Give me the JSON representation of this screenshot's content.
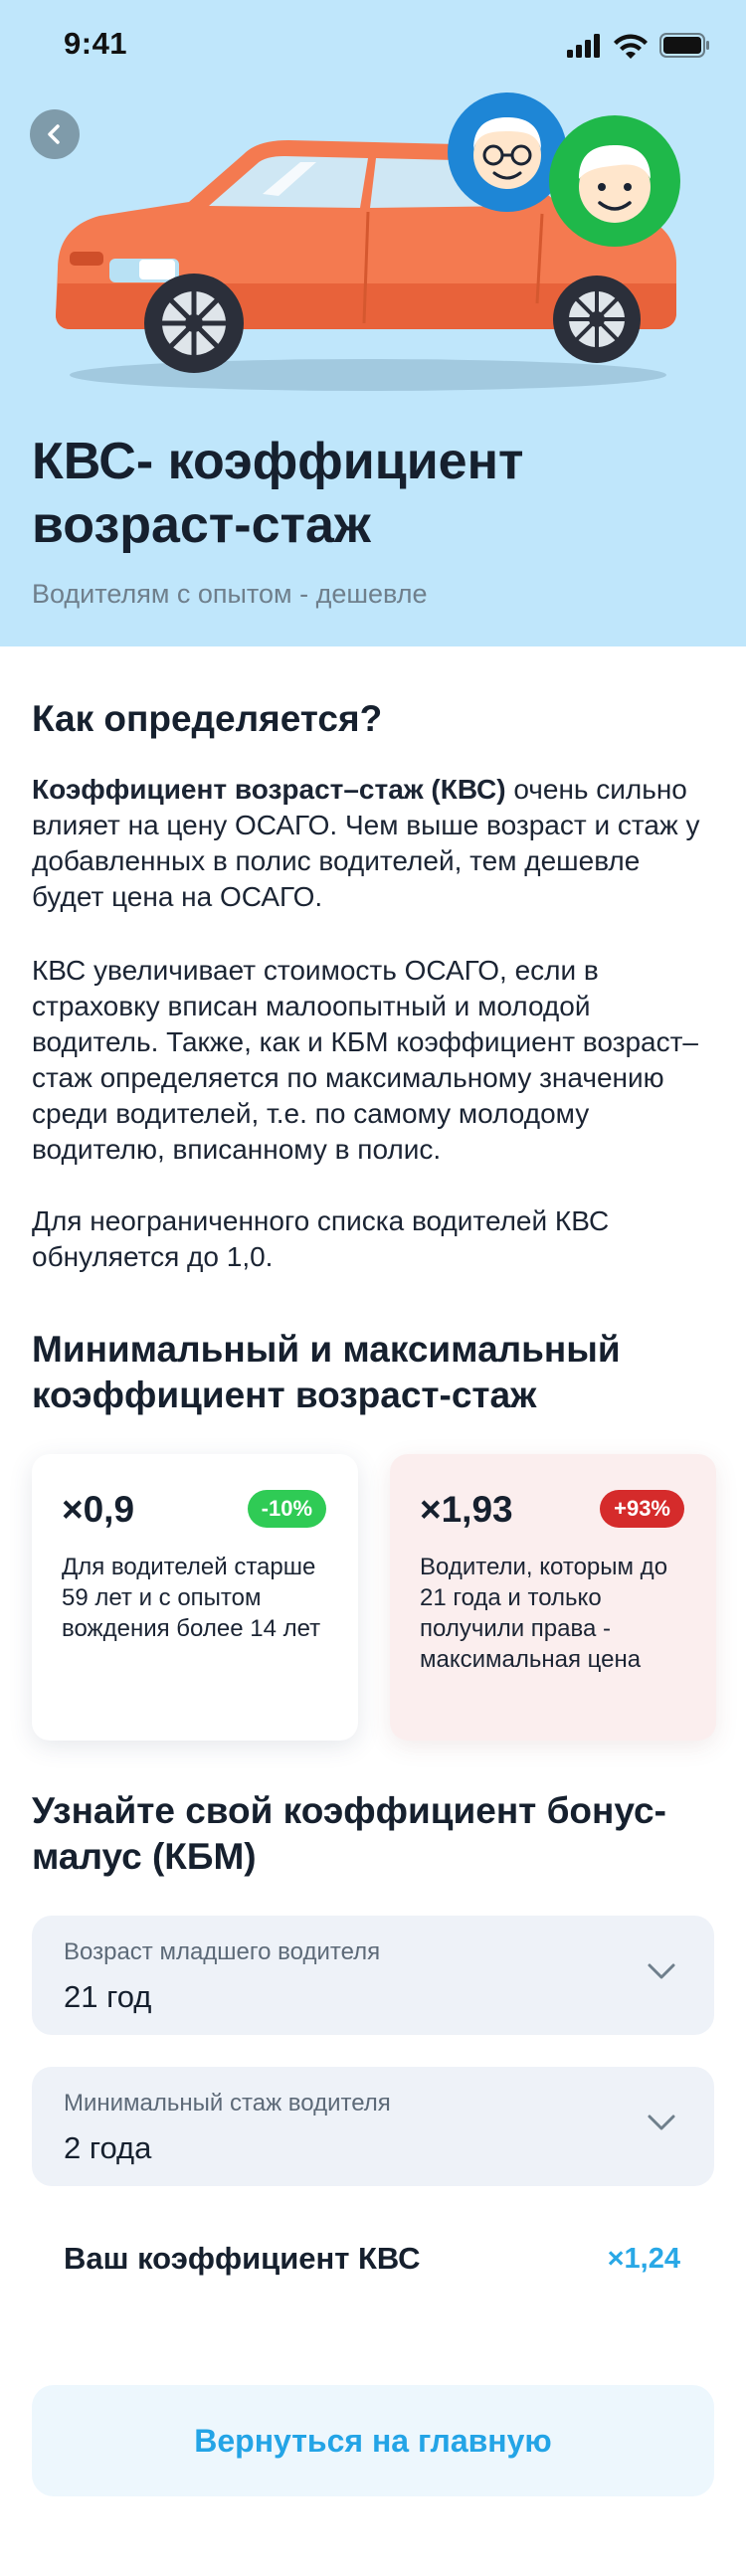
{
  "status_bar": {
    "time": "9:41"
  },
  "hero": {
    "title": "КВС- коэффициент возраст-стаж",
    "subtitle": "Водителям с опытом - дешевле"
  },
  "how": {
    "title": "Как определяется?",
    "p1_bold": "Коэффициент возраст–стаж (КВС)",
    "p1_rest": " очень сильно влияет на цену ОСАГО. Чем выше возраст и стаж у добавленных в полис водителей, тем дешевле будет цена на ОСАГО.",
    "p2": "КВС увеличивает стоимость ОСАГО, если в страховку вписан малоопытный и молодой водитель. Также, как и КБМ коэффициент возраст–стаж определяется по максимальному значению среди водителей, т.е. по самому молодому водителю, вписанному в полис.",
    "p3": "Для неограниченного списка водителей КВС обнуляется до 1,0."
  },
  "minmax": {
    "title": "Минимальный и максимальный коэффициент возраст-стаж",
    "min": {
      "value": "×0,9",
      "badge": "-10%",
      "desc": "Для водителей старше 59 лет и с опытом вождения более 14 лет"
    },
    "max": {
      "value": "×1,93",
      "badge": "+93%",
      "desc": "Водители, которым до 21 года и только получили права - максимальная цена"
    }
  },
  "calc": {
    "title": "Узнайте свой коэффициент бонус-малус (КБМ)",
    "age_label": "Возраст младшего водителя",
    "age_value": "21 год",
    "exp_label": "Минимальный стаж водителя",
    "exp_value": "2 года",
    "result_label": "Ваш коэффициент КВС",
    "result_value": "×1,24"
  },
  "home_button": "Вернуться на главную",
  "colors": {
    "hero_bg": "#bfe6fb",
    "accent": "#29a8e6",
    "green": "#2fcb55",
    "red": "#d52b2b",
    "car": "#f47a50"
  },
  "icons": [
    "back-arrow-icon",
    "chevron-down-icon",
    "signal-icon",
    "wifi-icon",
    "battery-icon",
    "elderly-driver-avatar-icon",
    "young-driver-avatar-icon"
  ]
}
